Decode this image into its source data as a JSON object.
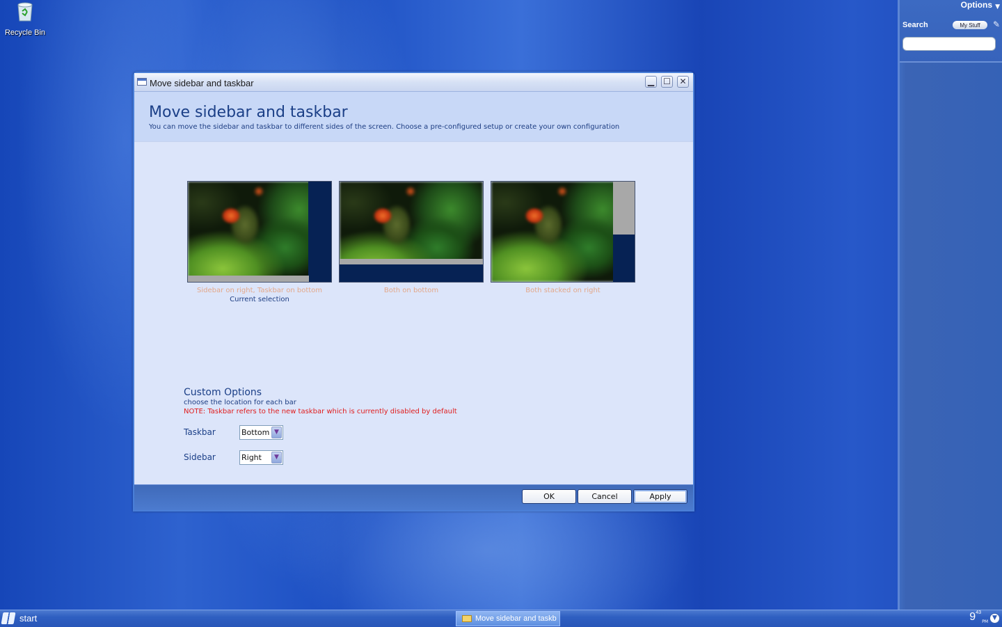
{
  "desktop": {
    "recycle_bin_label": "Recycle Bin"
  },
  "sidebar": {
    "options_label": "Options",
    "search_label": "Search",
    "my_stuff_label": "My Stuff",
    "search_value": ""
  },
  "window": {
    "title": "Move sidebar and taskbar",
    "heading": "Move sidebar and taskbar",
    "subtitle": "You can move the sidebar and taskbar to different sides of the screen. Choose a pre-configured setup or create your own configuration",
    "presets": [
      {
        "caption": "Sidebar on right, Taskbar on bottom",
        "status": "Current selection"
      },
      {
        "caption": "Both on bottom",
        "status": ""
      },
      {
        "caption": "Both stacked on right",
        "status": ""
      }
    ],
    "custom": {
      "title": "Custom Options",
      "subtitle": "choose the location for each bar",
      "note": "NOTE: Taskbar refers to the new taskbar which is currently disabled by default",
      "taskbar_label": "Taskbar",
      "taskbar_value": "Bottom",
      "sidebar_label": "Sidebar",
      "sidebar_value": "Right"
    },
    "buttons": {
      "ok": "OK",
      "cancel": "Cancel",
      "apply": "Apply"
    }
  },
  "taskbar": {
    "start_label": "start",
    "task_button": "Move sidebar and taskb",
    "clock_hour": "9",
    "clock_min": "43",
    "clock_ampm": "PM"
  },
  "colors": {
    "accent": "#1b3f87",
    "note": "#e01c1c",
    "caption": "#e3a88a",
    "bar": "#062254"
  }
}
